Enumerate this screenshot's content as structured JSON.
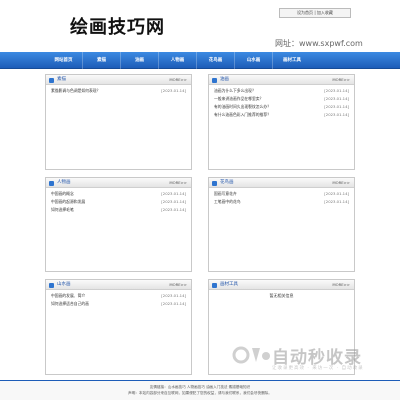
{
  "header": {
    "title": "绘画技巧网",
    "top_links": "设为首页 | 加入收藏",
    "url": "网址：www.sxpwf.com"
  },
  "nav": [
    "网站首页",
    "素描",
    "油画",
    "人物画",
    "花鸟画",
    "山水画",
    "画材工具"
  ],
  "panels": [
    {
      "title": "素描",
      "more": "MORE>>",
      "rows": [
        {
          "text": "素描影调与色调是如何表现？",
          "date": "[2023.01.14]"
        }
      ]
    },
    {
      "title": "油画",
      "more": "MORE>>",
      "rows": [
        {
          "text": "油画为什么下多么出现？",
          "date": "[2023.01.14]"
        },
        {
          "text": "一般来讲油画作品在哪里卖？",
          "date": "[2023.01.14]"
        },
        {
          "text": "有的油画时间久出现裂纹怎么办？",
          "date": "[2023.01.14]"
        },
        {
          "text": "有什么油画色彩入门推荐的推荐？",
          "date": "[2023.01.14]"
        }
      ]
    },
    {
      "title": "人物画",
      "more": "MORE>>",
      "rows": [
        {
          "text": "中国画的概念",
          "date": "[2023.01.14]"
        },
        {
          "text": "中国画的起源和发展",
          "date": "[2023.01.14]"
        },
        {
          "text": "如何选择毛笔",
          "date": "[2023.01.14]"
        }
      ]
    },
    {
      "title": "花鸟画",
      "more": "MORE>>",
      "rows": [
        {
          "text": "国画写意花卉",
          "date": "[2023.01.14]"
        },
        {
          "text": "工笔画中的花鸟",
          "date": "[2023.01.14]"
        }
      ]
    },
    {
      "title": "山水画",
      "more": "MORE>>",
      "rows": [
        {
          "text": "中国画的发展、简介",
          "date": "[2023.01.14]"
        },
        {
          "text": "如何选择适合自己的画",
          "date": "[2023.01.14]"
        }
      ]
    },
    {
      "title": "画材工具",
      "more": "MORE>>",
      "rows": [],
      "note": "暂无相关信息"
    }
  ],
  "footer": {
    "line1": "友情链接：山水画技巧 人物画技巧 油画入门技法 素描基础知识",
    "line2": "声明：本站内容部分来自互联网，如果侵犯了您的权益，请与我们联系，我们会尽快删除。"
  },
  "watermark": {
    "text": "自动秒收录",
    "slogan": "让收录更高效 · 来访一次 · 自动收录"
  },
  "colors": {
    "nav_blue": "#2e74cf",
    "panel_title": "#2255aa"
  }
}
